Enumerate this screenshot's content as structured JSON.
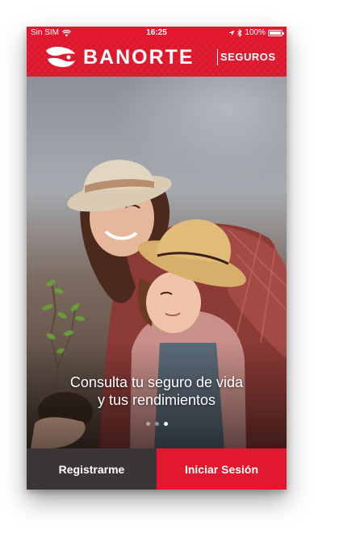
{
  "status_bar": {
    "carrier": "Sin SIM",
    "time": "16:25",
    "battery": "100%",
    "battery_level": 1.0
  },
  "header": {
    "brand": "BANORTE",
    "subbrand": "SEGUROS"
  },
  "hero": {
    "caption_line1": "Consulta tu seguro de vida",
    "caption_line2": "y tus rendimientos",
    "total_slides": 3,
    "active_slide": 3
  },
  "actions": {
    "register_label": "Registrarme",
    "login_label": "Iniciar Sesión"
  },
  "colors": {
    "brand_red": "#e1182e",
    "dark_button": "#3b3537"
  }
}
